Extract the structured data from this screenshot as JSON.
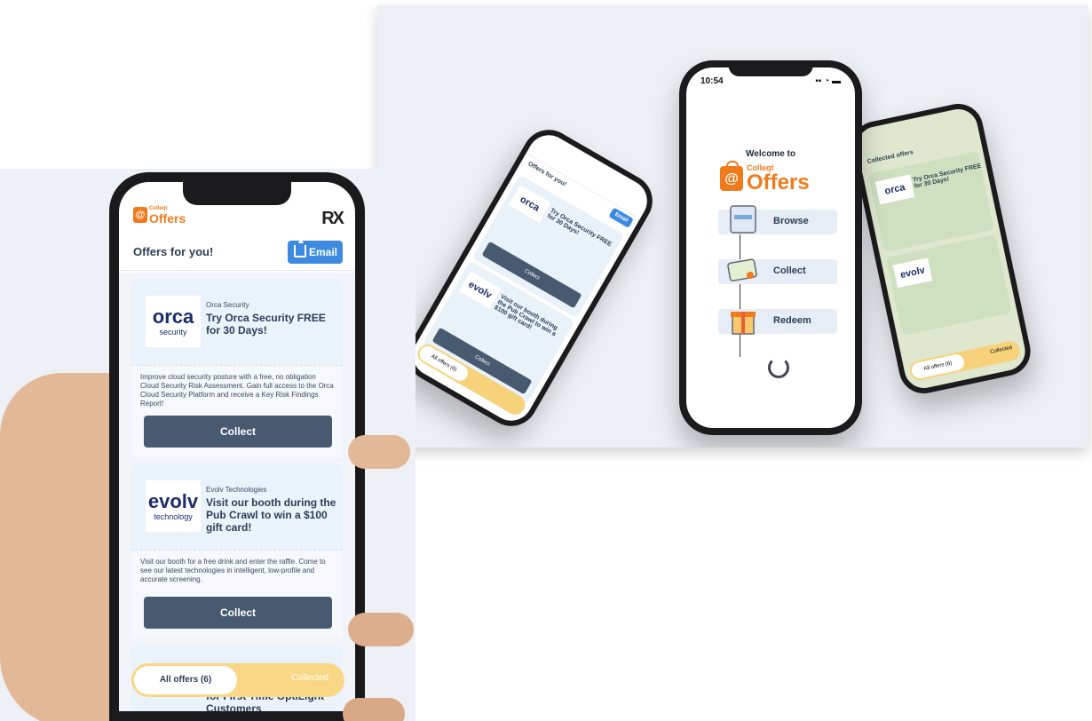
{
  "promo": {
    "status_time": "10:54",
    "welcome": "Welcome to",
    "brand_small": "Colleqt",
    "brand_big": "Offers",
    "steps": [
      "Browse",
      "Collect",
      "Redeem"
    ],
    "left_phone": {
      "subtitle": "Offers for you!",
      "email": "Email",
      "card1_title": "Try Orca Security FREE for 30 Days!",
      "card2_title": "Visit our booth during the Pub Crawl to win a $100 gift card!",
      "collect": "Collect",
      "tab_all": "All offers (6)",
      "logo1": "orca",
      "logo2": "evolv"
    },
    "right_phone": {
      "header": "Collected offers",
      "card_title": "Try Orca Security FREE for 30 Days!",
      "tab_all": "All offers (6)",
      "tab_collected": "Collected"
    }
  },
  "app": {
    "brand_small": "Colleqt",
    "brand_big": "Offers",
    "partner_logo": "RX",
    "subtitle": "Offers for you!",
    "email_label": "Email",
    "cards": [
      {
        "logo_main": "orca",
        "logo_sub": "security",
        "vendor": "Orca Security",
        "title": "Try Orca Security FREE for 30 Days!",
        "description": "Improve cloud security posture with a free, no obligation Cloud Security Risk Assessment. Gain full access to the Orca Cloud Security Platform and receive a Key Risk Findings Report!",
        "button": "Collect"
      },
      {
        "logo_main": "evolv",
        "logo_sub": "technology",
        "vendor": "Evolv Technologies",
        "title": "Visit our booth during the Pub Crawl to win a $100 gift card!",
        "description": "Visit our booth for a free drink and enter the raffle. Come to see our latest technologies in intelligent, low-profile and accurate screening.",
        "button": "Collect"
      }
    ],
    "peek_title": "for First Time OptiLight Customers",
    "tabs": {
      "all": "All offers (6)",
      "collected": "Collected"
    }
  }
}
